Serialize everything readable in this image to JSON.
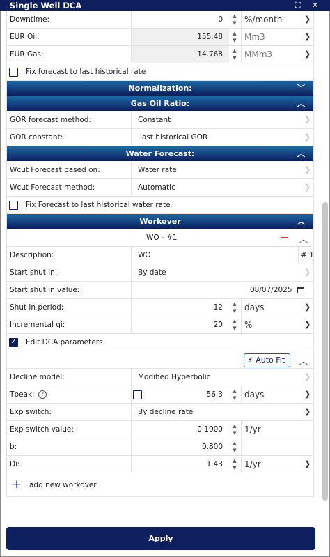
{
  "window": {
    "title": "Single Well DCA",
    "expand_icon": "⛶",
    "close_icon": "✕"
  },
  "params": {
    "downtime": {
      "label": "Downtime:",
      "value": "0",
      "unit": "%/month"
    },
    "eur_oil": {
      "label": "EUR Oil:",
      "value": "155.48",
      "unit": "Mm3"
    },
    "eur_gas": {
      "label": "EUR Gas:",
      "value": "14.768",
      "unit": "MMm3"
    },
    "fix_forecast": {
      "label": "Fix forecast to last historical rate",
      "checked": false
    }
  },
  "normalization": {
    "title": "Normalization:"
  },
  "gas_oil_ratio": {
    "title": "Gas Oil Ratio:",
    "method": {
      "label": "GOR forecast method:",
      "value": "Constant"
    },
    "constant": {
      "label": "GOR constant:",
      "value": "Last historical GOR"
    }
  },
  "water_forecast": {
    "title": "Water Forecast:",
    "based_on": {
      "label": "Wcut Forecast based on:",
      "value": "Water rate"
    },
    "method": {
      "label": "Wcut Forecast method:",
      "value": "Automatic"
    },
    "fix_water": {
      "label": "Fix Forecast to last historical water rate",
      "checked": false
    }
  },
  "workover": {
    "title": "Workover",
    "item_title": "WO - #1",
    "description": {
      "label": "Description:",
      "value": "WO",
      "index": "# 1"
    },
    "start_shut_in": {
      "label": "Start shut in:",
      "value": "By date"
    },
    "start_shut_in_value": {
      "label": "Start shut in value:",
      "value": "08/07/2025"
    },
    "shut_in_period": {
      "label": "Shut in period:",
      "value": "12",
      "unit": "days"
    },
    "incremental_qi": {
      "label": "Incremental qi:",
      "value": "20",
      "unit": "%"
    },
    "edit_dca": {
      "label": "Edit DCA parameters",
      "checked": true
    },
    "auto_fit": "Auto Fit",
    "decline_model": {
      "label": "Decline model:",
      "value": "Modified Hyperbolic"
    },
    "tpeak": {
      "label": "Tpeak:",
      "value": "56.3",
      "unit": "days",
      "checked": false
    },
    "exp_switch": {
      "label": "Exp switch:",
      "value": "By decline rate"
    },
    "exp_switch_value": {
      "label": "Exp switch value:",
      "value": "0.1000",
      "unit": "1/yr"
    },
    "b": {
      "label": "b:",
      "value": "0.800"
    },
    "di": {
      "label": "Di:",
      "value": "1.43",
      "unit": "1/yr"
    },
    "add_new": "add new workover"
  },
  "footer": {
    "apply": "Apply"
  },
  "colors": {
    "navy": "#0d1f5c",
    "section_gradient_top": "#1e68a6",
    "minus_red": "#d9342b"
  }
}
